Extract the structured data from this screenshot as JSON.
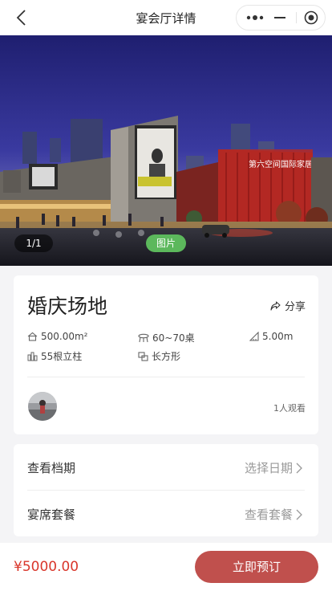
{
  "nav": {
    "title": "宴会厅详情"
  },
  "hero": {
    "counter": "1/1",
    "picture_label": "图片",
    "sign_text": "第六空间国际家居"
  },
  "venue": {
    "name": "婚庆场地",
    "share_label": "分享",
    "area": "500.00m²",
    "tables": "60~70桌",
    "height": "5.00m",
    "pillars": "55根立柱",
    "shape": "长方形",
    "views": "1人观看"
  },
  "options": [
    {
      "label": "查看档期",
      "action": "选择日期"
    },
    {
      "label": "宴席套餐",
      "action": "查看套餐"
    }
  ],
  "footer": {
    "price": "¥5000.00",
    "book_label": "立即预订"
  },
  "colors": {
    "accent": "#c0504d",
    "price": "#d9362b",
    "picture_badge": "#5cb85c"
  }
}
